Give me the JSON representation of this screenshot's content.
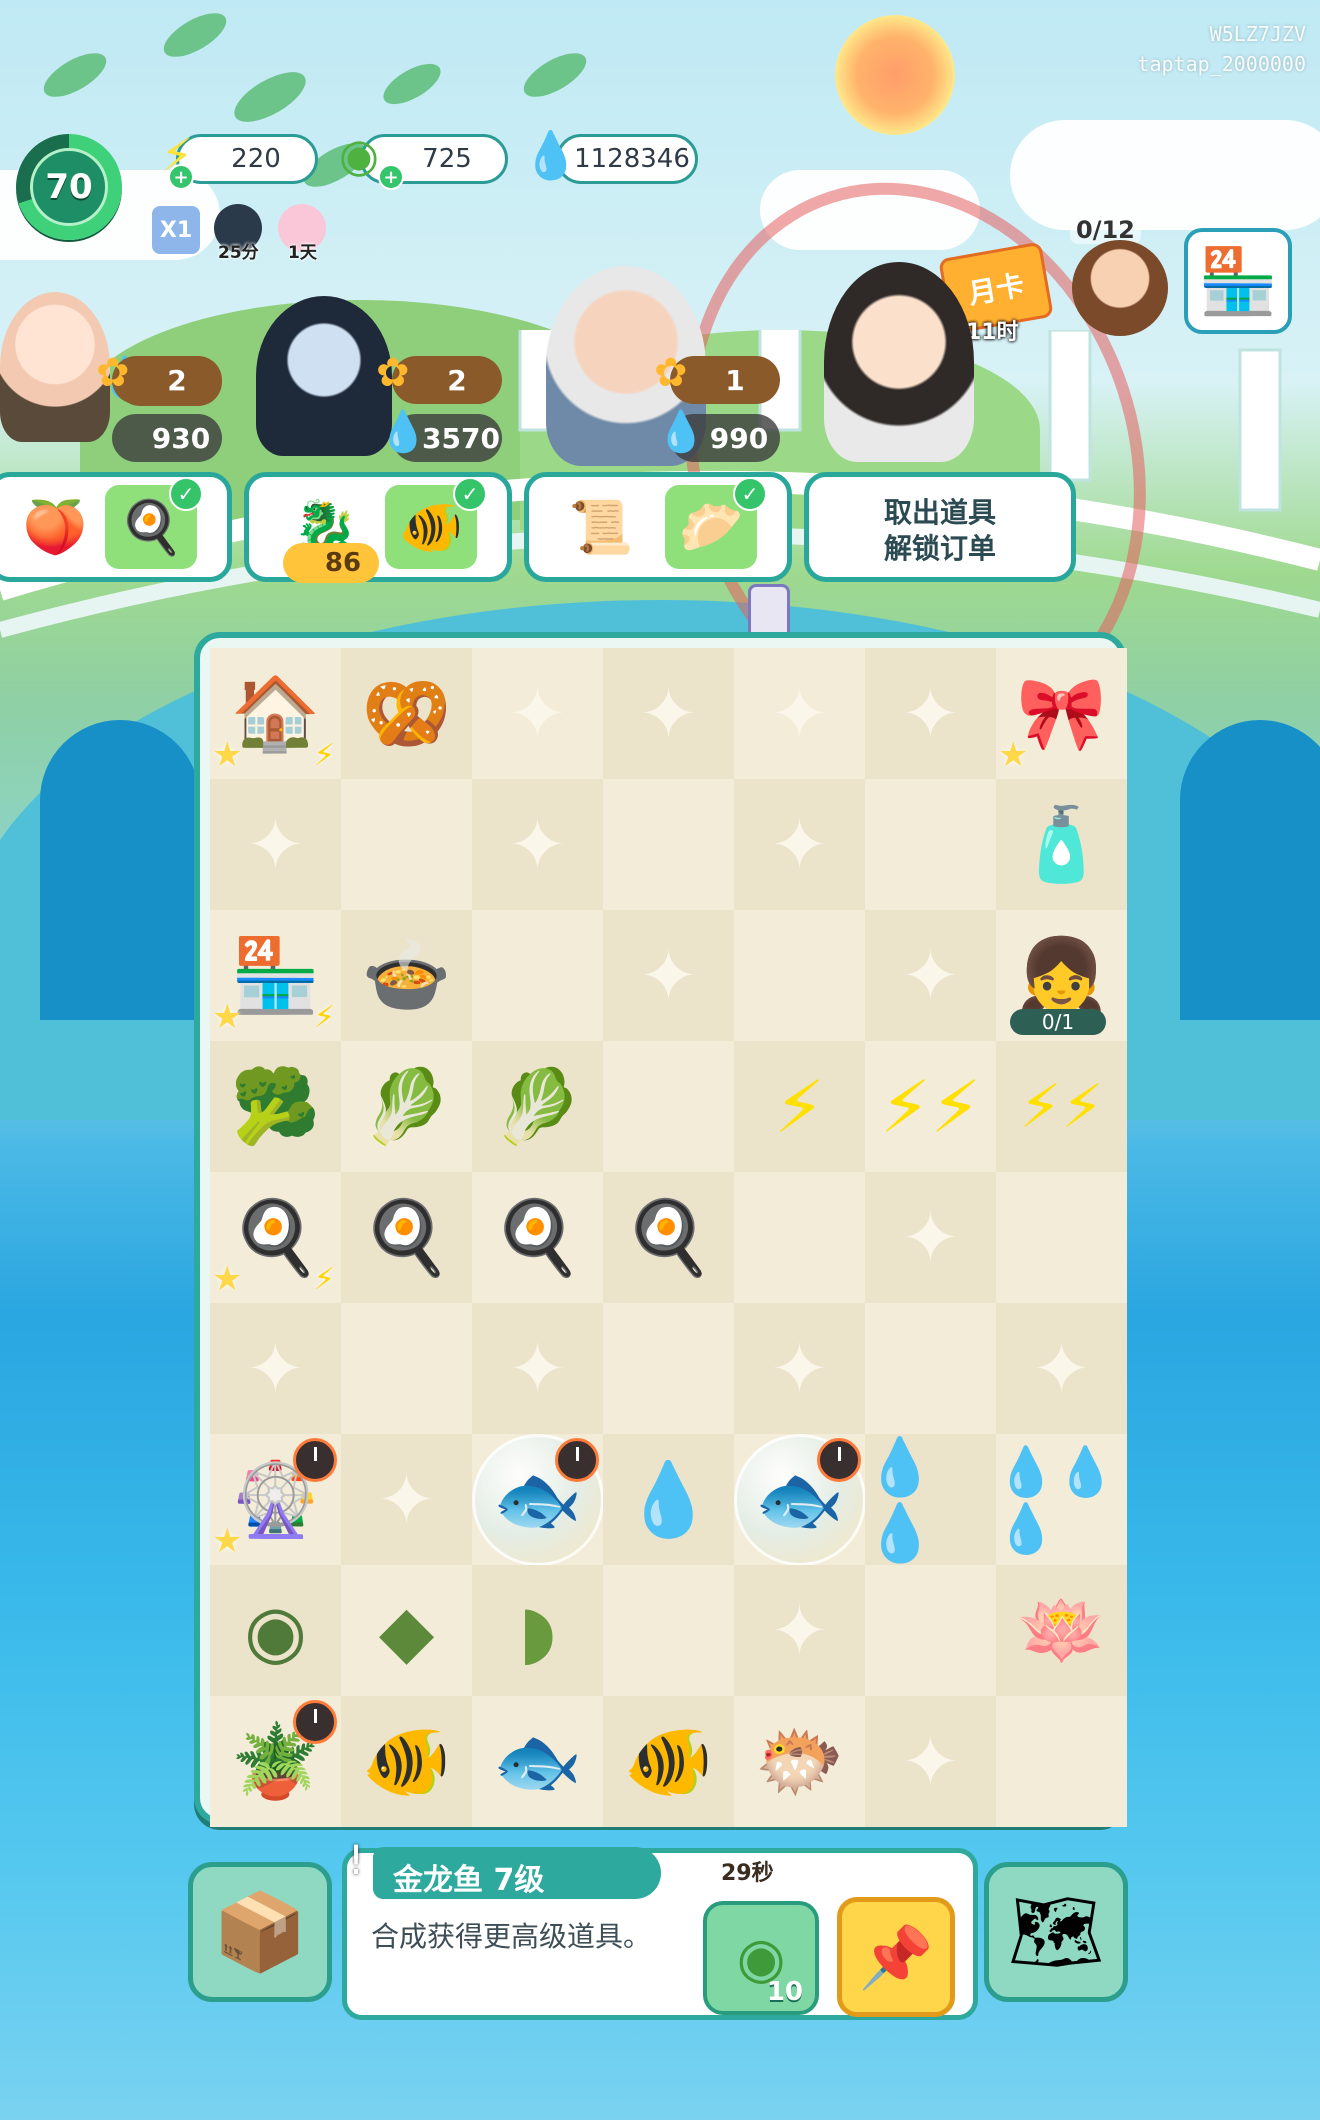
{
  "watermark": {
    "code": "W5LZ7JZV",
    "user": "taptap_2000000"
  },
  "player": {
    "level": "70"
  },
  "resources": {
    "energy": "220",
    "coins": "725",
    "gems": "1128346"
  },
  "buffs": {
    "multiplier": "X1",
    "buff2_time": "25分",
    "buff3_time": "1天"
  },
  "customers": [
    {
      "name": "customer-child",
      "flowers": "2",
      "reward": "930"
    },
    {
      "name": "customer-ghost-girl",
      "flowers": "2",
      "reward": "3570"
    },
    {
      "name": "customer-old-man",
      "flowers": "1",
      "reward": "990"
    }
  ],
  "orders": {
    "order2_cost": "86",
    "unlock_line1": "取出道具",
    "unlock_line2": "解锁订单"
  },
  "top_right": {
    "month_card": "月卡",
    "month_card_time": "11时",
    "npc_progress": "0/12"
  },
  "board": {
    "npc_progress": "0/1"
  },
  "selected_item": {
    "name_level": "金龙鱼 7级",
    "description": "合成获得更高级道具。",
    "sell_value": "10",
    "countdown": "29秒"
  }
}
